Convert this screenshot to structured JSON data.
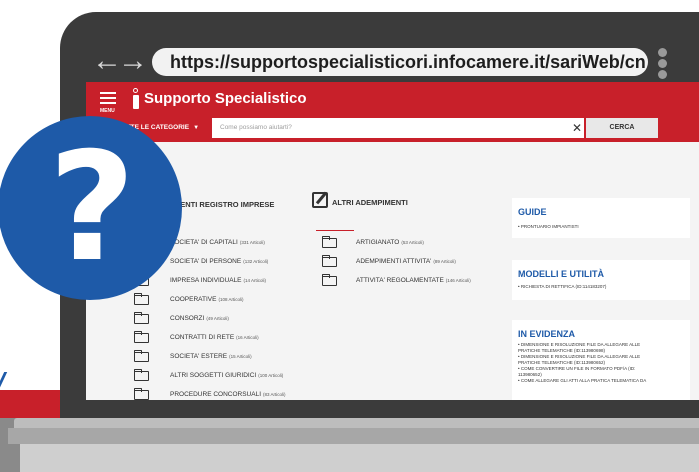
{
  "browser": {
    "nav_arrows": "←→",
    "url": "https://supportospecialisticori.infocamere.it/sariWeb/cn"
  },
  "header": {
    "menu_label": "MENU",
    "title": "Supporto Specialistico"
  },
  "search": {
    "category": "UTTE LE CATEGORIE",
    "placeholder": "Come possiamo aiutarti?",
    "clear": "✕",
    "button": "CERCA"
  },
  "columns": {
    "registro_heading": "MENTI REGISTRO IMPRESE",
    "altri_heading": "ALTRI ADEMPIMENTI"
  },
  "registro_items": [
    {
      "label": "SOCIETA' DI CAPITALI",
      "count": "(331 Articoli)"
    },
    {
      "label": "SOCIETA' DI PERSONE",
      "count": "(132 Articoli)"
    },
    {
      "label": "IMPRESA INDIVIDUALE",
      "count": "(14 Articoli)"
    },
    {
      "label": "COOPERATIVE",
      "count": "(108 Articoli)"
    },
    {
      "label": "CONSORZI",
      "count": "(49 Articoli)"
    },
    {
      "label": "CONTRATTI DI RETE",
      "count": "(16 Articoli)"
    },
    {
      "label": "SOCIETA' ESTERE",
      "count": "(15 Articoli)"
    },
    {
      "label": "ALTRI SOGGETTI GIURIDICI",
      "count": "(100 Articoli)"
    },
    {
      "label": "PROCEDURE CONCORSUALI",
      "count": "(83 Articoli)"
    }
  ],
  "altri_items": [
    {
      "label": "ARTIGIANATO",
      "count": "(53 Articoli)"
    },
    {
      "label": "ADEMPIMENTI ATTIVITA'",
      "count": "(89 Articoli)"
    },
    {
      "label": "ATTIVITA' REGOLAMENTATE",
      "count": "(146 Articoli)"
    }
  ],
  "sidebar": {
    "guide_title": "GUIDE",
    "guide_items": [
      "• PRONTUARIO IMPIANTISTI"
    ],
    "modelli_title": "MODELLI E UTILITÀ",
    "modelli_items": [
      "• RICHIESTA DI RETTIFICA (ID:114183207)"
    ],
    "evidenza_title": "IN EVIDENZA",
    "evidenza_items": [
      "• DIMENSIONE E RISOLUZIONE FILE DA ALLEGARE ALLE",
      "PRATICHE TELEMATICHE (ID:113980698)",
      "• DIMENSIONE E RISOLUZIONE FILE DA ALLEGARE ALLE",
      "PRATICHE TELEMATICHE (ID:113980652)",
      "• COME CONVERTIRE UN FILE IN FORMATO PDF/A (ID:",
      "113980652)",
      "• COME ALLEGARE GLI ATTI ALLA PRATICA TELEMATICA DA"
    ]
  },
  "overlay": {
    "help_mark": "?"
  },
  "colors": {
    "brand_red": "#c8202a",
    "accent_blue": "#1e5aa8",
    "frame_dark": "#3b3b3b"
  }
}
